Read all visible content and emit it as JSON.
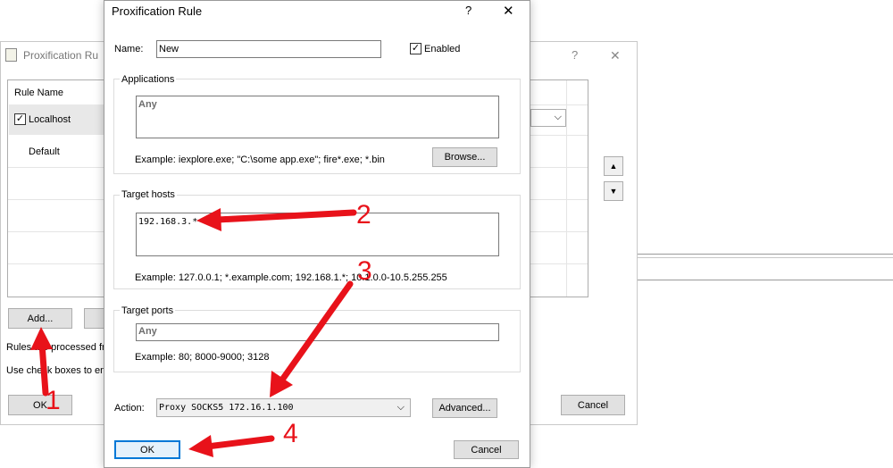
{
  "background_window": {
    "title": "Proxification Ru",
    "help_glyph": "?",
    "close_glyph": "✕",
    "table": {
      "header": "Rule Name",
      "rows": [
        {
          "name": "Localhost",
          "checked": true
        },
        {
          "name": "Default",
          "checked": false
        }
      ]
    },
    "add_button": "Add...",
    "info_line_1": "Rules are processed fr",
    "info_line_2": "Use check boxes to en",
    "ok_button": "OK",
    "cancel_button": "Cancel",
    "up_glyph": "▲",
    "down_glyph": "▼",
    "dropdown_glyph": "⌵"
  },
  "dialog": {
    "title": "Proxification Rule",
    "help_glyph": "?",
    "close_glyph": "✕",
    "name_label": "Name:",
    "name_value": "New",
    "enabled_label": "Enabled",
    "enabled_checked": true,
    "applications": {
      "title": "Applications",
      "value": "Any",
      "example": "Example: iexplore.exe; \"C:\\some app.exe\"; fire*.exe; *.bin",
      "browse_button": "Browse..."
    },
    "target_hosts": {
      "title": "Target hosts",
      "value": "192.168.3.*",
      "example": "Example: 127.0.0.1; *.example.com; 192.168.1.*; 10.1.0.0-10.5.255.255"
    },
    "target_ports": {
      "title": "Target ports",
      "value": "Any",
      "example": "Example: 80; 8000-9000; 3128"
    },
    "action_label": "Action:",
    "action_value": "Proxy SOCKS5 172.16.1.100",
    "dropdown_glyph": "⌵",
    "advanced_button": "Advanced...",
    "ok_button": "OK",
    "cancel_button": "Cancel"
  },
  "annotations": {
    "color": "#e8121a",
    "numbers": [
      "1",
      "2",
      "3",
      "4"
    ]
  }
}
